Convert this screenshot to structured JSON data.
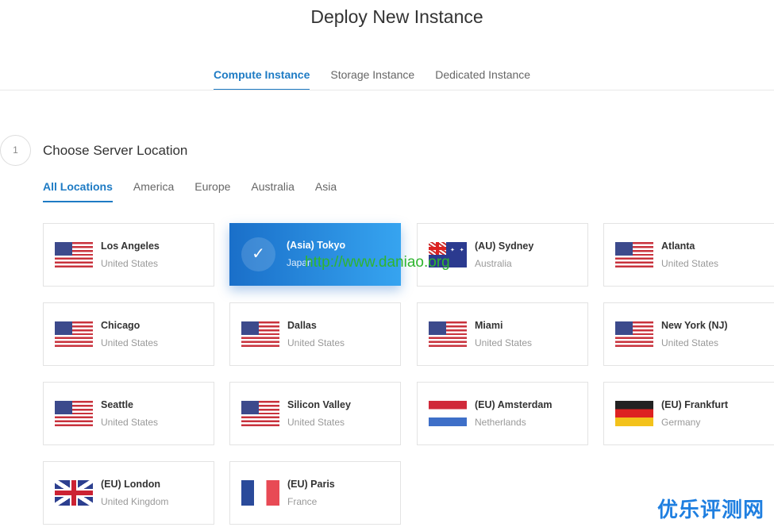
{
  "title": "Deploy New Instance",
  "tabs": [
    "Compute Instance",
    "Storage Instance",
    "Dedicated Instance"
  ],
  "step": {
    "number": "1",
    "title": "Choose Server Location"
  },
  "location_tabs": [
    "All Locations",
    "America",
    "Europe",
    "Australia",
    "Asia"
  ],
  "locations": [
    {
      "city": "Los Angeles",
      "country": "United States",
      "flag": "us"
    },
    {
      "city": "(Asia) Tokyo",
      "country": "Japan",
      "flag": "jp",
      "selected": true
    },
    {
      "city": "(AU) Sydney",
      "country": "Australia",
      "flag": "au"
    },
    {
      "city": "Atlanta",
      "country": "United States",
      "flag": "us"
    },
    {
      "city": "Chicago",
      "country": "United States",
      "flag": "us"
    },
    {
      "city": "Dallas",
      "country": "United States",
      "flag": "us"
    },
    {
      "city": "Miami",
      "country": "United States",
      "flag": "us"
    },
    {
      "city": "New York (NJ)",
      "country": "United States",
      "flag": "us"
    },
    {
      "city": "Seattle",
      "country": "United States",
      "flag": "us"
    },
    {
      "city": "Silicon Valley",
      "country": "United States",
      "flag": "us"
    },
    {
      "city": "(EU) Amsterdam",
      "country": "Netherlands",
      "flag": "nl"
    },
    {
      "city": "(EU) Frankfurt",
      "country": "Germany",
      "flag": "de"
    },
    {
      "city": "(EU) London",
      "country": "United Kingdom",
      "flag": "uk"
    },
    {
      "city": "(EU) Paris",
      "country": "France",
      "flag": "fr"
    }
  ],
  "watermarks": [
    "http://www.daniao.org",
    "优乐评测网"
  ],
  "colors": {
    "accent": "#1e7bc4"
  }
}
